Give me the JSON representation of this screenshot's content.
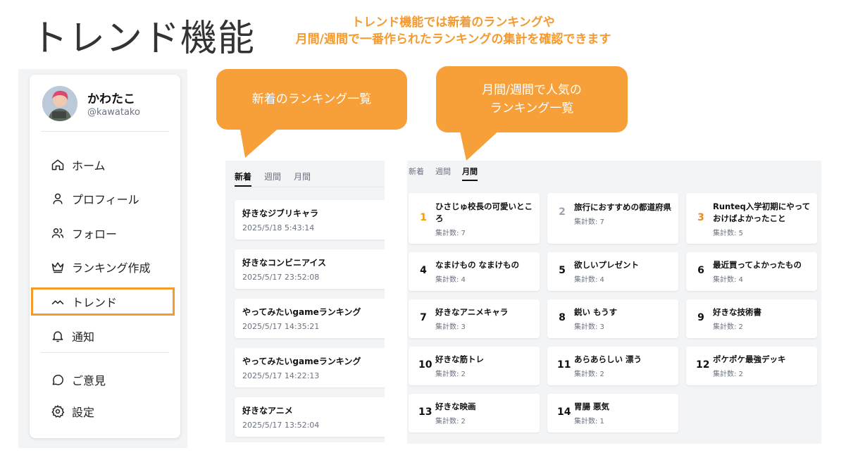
{
  "slide": {
    "title": "トレンド機能",
    "subtitle_line1": "トレンド機能では新着のランキングや",
    "subtitle_line2": "月間/週間で一番作られたランキングの集計を確認できます",
    "accent_color": "#f59a2f"
  },
  "sidebar": {
    "profile": {
      "name": "かわたこ",
      "handle": "@kawatako"
    },
    "items": [
      {
        "label": "ホーム",
        "icon": "home-icon"
      },
      {
        "label": "プロフィール",
        "icon": "user-icon"
      },
      {
        "label": "フォロー",
        "icon": "users-icon"
      },
      {
        "label": "ランキング作成",
        "icon": "crown-icon"
      },
      {
        "label": "トレンド",
        "icon": "trend-icon"
      },
      {
        "label": "通知",
        "icon": "bell-icon"
      },
      {
        "label": "ご意見",
        "icon": "chat-icon"
      },
      {
        "label": "設定",
        "icon": "gear-icon"
      }
    ]
  },
  "callouts": {
    "new": "新着のランキング一覧",
    "monthly_line1": "月間/週間で人気の",
    "monthly_line2": "ランキング一覧"
  },
  "new_panel": {
    "tabs": [
      "新着",
      "週間",
      "月間"
    ],
    "active_tab": "新着",
    "items": [
      {
        "title": "好きなジブリキャラ",
        "date": "2025/5/18 5:43:14"
      },
      {
        "title": "好きなコンビニアイス",
        "date": "2025/5/17 23:52:08"
      },
      {
        "title": "やってみたいgameランキング",
        "date": "2025/5/17 14:35:21"
      },
      {
        "title": "やってみたいgameランキング",
        "date": "2025/5/17 14:22:13"
      },
      {
        "title": "好きなアニメ",
        "date": "2025/5/17 13:52:04"
      }
    ]
  },
  "ranking_panel": {
    "tabs": [
      "新着",
      "週間",
      "月間"
    ],
    "active_tab": "月間",
    "items": [
      {
        "rank": "1",
        "title": "ひさじゅ校長の可愛いところ",
        "count": "集計数: 7"
      },
      {
        "rank": "2",
        "title": "旅行におすすめの都道府県",
        "count": "集計数: 7"
      },
      {
        "rank": "3",
        "title": "Runteq入学初期にやっておけばよかったこと",
        "count": "集計数: 5"
      },
      {
        "rank": "4",
        "title": "なまけもの なまけもの",
        "count": "集計数: 4"
      },
      {
        "rank": "5",
        "title": "欲しいプレゼント",
        "count": "集計数: 4"
      },
      {
        "rank": "6",
        "title": "最近買ってよかったもの",
        "count": "集計数: 4"
      },
      {
        "rank": "7",
        "title": "好きなアニメキャラ",
        "count": "集計数: 3"
      },
      {
        "rank": "8",
        "title": "鋭い もうす",
        "count": "集計数: 3"
      },
      {
        "rank": "9",
        "title": "好きな技術書",
        "count": "集計数: 2"
      },
      {
        "rank": "10",
        "title": "好きな筋トレ",
        "count": "集計数: 2"
      },
      {
        "rank": "11",
        "title": "あらあらしい 漂う",
        "count": "集計数: 2"
      },
      {
        "rank": "12",
        "title": "ポケポケ最強デッキ",
        "count": "集計数: 2"
      },
      {
        "rank": "13",
        "title": "好きな映画",
        "count": "集計数: 2"
      },
      {
        "rank": "14",
        "title": "胃腸 悪気",
        "count": "集計数: 1"
      }
    ]
  }
}
